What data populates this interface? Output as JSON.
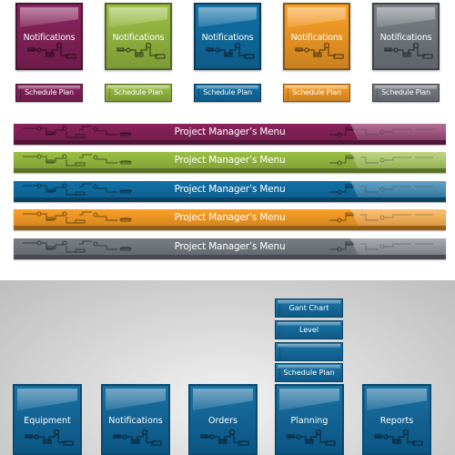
{
  "colors": {
    "purple": "#7a1f52",
    "green": "#8aab3c",
    "blue": "#0f6596",
    "orange": "#e08f22",
    "gray": "#6c7077"
  },
  "top_tiles": [
    {
      "label": "Notifications",
      "color": "purple"
    },
    {
      "label": "Notifications",
      "color": "green"
    },
    {
      "label": "Notifications",
      "color": "blue"
    },
    {
      "label": "Notifications",
      "color": "orange"
    },
    {
      "label": "Notifications",
      "color": "gray"
    }
  ],
  "small_buttons": [
    {
      "label": "Schedule Plan",
      "color": "purple"
    },
    {
      "label": "Schedule Plan",
      "color": "green"
    },
    {
      "label": "Schedule Plan",
      "color": "blue"
    },
    {
      "label": "Schedule Plan",
      "color": "orange"
    },
    {
      "label": "Schedule Plan",
      "color": "gray"
    }
  ],
  "menu_bars": [
    {
      "label": "Project Manager’s Menu",
      "color": "purple"
    },
    {
      "label": "Project Manager’s Menu",
      "color": "green"
    },
    {
      "label": "Project Manager’s Menu",
      "color": "blue"
    },
    {
      "label": "Project Manager’s Menu",
      "color": "orange"
    },
    {
      "label": "Project Manager’s Menu",
      "color": "gray"
    }
  ],
  "submenu": [
    {
      "label": "Gant Chart"
    },
    {
      "label": "Level"
    },
    {
      "label": ""
    },
    {
      "label": "Schedule Plan"
    }
  ],
  "bottom_tiles": [
    {
      "label": "Equipment"
    },
    {
      "label": "Notifications"
    },
    {
      "label": "Orders"
    },
    {
      "label": "Planning"
    },
    {
      "label": "Reports"
    }
  ],
  "icons": {
    "circuit": "circuit-diagram-icon"
  }
}
